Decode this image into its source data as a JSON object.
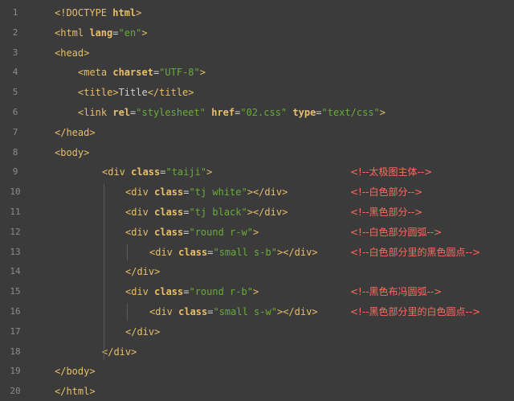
{
  "colors": {
    "background": "#3b3b3b",
    "line_number": "#8c8c8c",
    "tag": "#e8bf6a",
    "attribute_value": "#6aab3a",
    "plain": "#cfcfcf",
    "comment": "#ff6b5f"
  },
  "lines": [
    {
      "num": "1",
      "indent": 0,
      "tokens": [
        {
          "t": "doctype",
          "v": "<!DOCTYPE "
        },
        {
          "t": "doctype-kw",
          "v": "html"
        },
        {
          "t": "doctype",
          "v": ">"
        }
      ],
      "comment": ""
    },
    {
      "num": "2",
      "indent": 0,
      "tokens": [
        {
          "t": "tag",
          "v": "<html "
        },
        {
          "t": "attr",
          "v": "lang"
        },
        {
          "t": "eq",
          "v": "="
        },
        {
          "t": "val",
          "v": "\"en\""
        },
        {
          "t": "tag",
          "v": ">"
        }
      ],
      "comment": ""
    },
    {
      "num": "3",
      "indent": 0,
      "tokens": [
        {
          "t": "tag",
          "v": "<head>"
        }
      ],
      "comment": ""
    },
    {
      "num": "4",
      "indent": 1,
      "tokens": [
        {
          "t": "tag",
          "v": "<meta "
        },
        {
          "t": "attr",
          "v": "charset"
        },
        {
          "t": "eq",
          "v": "="
        },
        {
          "t": "val",
          "v": "\"UTF-8\""
        },
        {
          "t": "tag",
          "v": ">"
        }
      ],
      "comment": ""
    },
    {
      "num": "5",
      "indent": 1,
      "tokens": [
        {
          "t": "tag",
          "v": "<title>"
        },
        {
          "t": "text",
          "v": "Title"
        },
        {
          "t": "tag",
          "v": "</title>"
        }
      ],
      "comment": ""
    },
    {
      "num": "6",
      "indent": 1,
      "tokens": [
        {
          "t": "tag",
          "v": "<link "
        },
        {
          "t": "attr",
          "v": "rel"
        },
        {
          "t": "eq",
          "v": "="
        },
        {
          "t": "val",
          "v": "\"stylesheet\""
        },
        {
          "t": "text",
          "v": " "
        },
        {
          "t": "attr",
          "v": "href"
        },
        {
          "t": "eq",
          "v": "="
        },
        {
          "t": "val",
          "v": "\"02.css\""
        },
        {
          "t": "text",
          "v": " "
        },
        {
          "t": "attr",
          "v": "type"
        },
        {
          "t": "eq",
          "v": "="
        },
        {
          "t": "val",
          "v": "\"text/css\""
        },
        {
          "t": "tag",
          "v": ">"
        }
      ],
      "comment": ""
    },
    {
      "num": "7",
      "indent": 0,
      "tokens": [
        {
          "t": "tag",
          "v": "</head>"
        }
      ],
      "comment": ""
    },
    {
      "num": "8",
      "indent": 0,
      "tokens": [
        {
          "t": "tag",
          "v": "<body>"
        }
      ],
      "comment": ""
    },
    {
      "num": "9",
      "indent": 2,
      "tokens": [
        {
          "t": "tag",
          "v": "<div "
        },
        {
          "t": "attr",
          "v": "class"
        },
        {
          "t": "eq",
          "v": "="
        },
        {
          "t": "val",
          "v": "\"taiji\""
        },
        {
          "t": "tag",
          "v": ">"
        }
      ],
      "comment": "<!--太极图主体-->"
    },
    {
      "num": "10",
      "indent": 3,
      "tokens": [
        {
          "t": "tag",
          "v": "<div "
        },
        {
          "t": "attr",
          "v": "class"
        },
        {
          "t": "eq",
          "v": "="
        },
        {
          "t": "val",
          "v": "\"tj white\""
        },
        {
          "t": "tag",
          "v": "></div>"
        }
      ],
      "comment": "<!--白色部分-->"
    },
    {
      "num": "11",
      "indent": 3,
      "tokens": [
        {
          "t": "tag",
          "v": "<div "
        },
        {
          "t": "attr",
          "v": "class"
        },
        {
          "t": "eq",
          "v": "="
        },
        {
          "t": "val",
          "v": "\"tj black\""
        },
        {
          "t": "tag",
          "v": "></div>"
        }
      ],
      "comment": "<!--黑色部分-->"
    },
    {
      "num": "12",
      "indent": 3,
      "tokens": [
        {
          "t": "tag",
          "v": "<div "
        },
        {
          "t": "attr",
          "v": "class"
        },
        {
          "t": "eq",
          "v": "="
        },
        {
          "t": "val",
          "v": "\"round r-w\""
        },
        {
          "t": "tag",
          "v": ">"
        }
      ],
      "comment": "<!--白色部分圆弧-->"
    },
    {
      "num": "13",
      "indent": 4,
      "tokens": [
        {
          "t": "tag",
          "v": "<div "
        },
        {
          "t": "attr",
          "v": "class"
        },
        {
          "t": "eq",
          "v": "="
        },
        {
          "t": "val",
          "v": "\"small s-b\""
        },
        {
          "t": "tag",
          "v": "></div>"
        }
      ],
      "comment": "<!--白色部分里的黑色圆点-->"
    },
    {
      "num": "14",
      "indent": 3,
      "tokens": [
        {
          "t": "tag",
          "v": "</div>"
        }
      ],
      "comment": ""
    },
    {
      "num": "15",
      "indent": 3,
      "tokens": [
        {
          "t": "tag",
          "v": "<div "
        },
        {
          "t": "attr",
          "v": "class"
        },
        {
          "t": "eq",
          "v": "="
        },
        {
          "t": "val",
          "v": "\"round r-b\""
        },
        {
          "t": "tag",
          "v": ">"
        }
      ],
      "comment": "<!--黑色布冯圆弧-->"
    },
    {
      "num": "16",
      "indent": 4,
      "tokens": [
        {
          "t": "tag",
          "v": "<div "
        },
        {
          "t": "attr",
          "v": "class"
        },
        {
          "t": "eq",
          "v": "="
        },
        {
          "t": "val",
          "v": "\"small s-w\""
        },
        {
          "t": "tag",
          "v": "></div>"
        }
      ],
      "comment": "<!--黑色部分里的白色圆点-->"
    },
    {
      "num": "17",
      "indent": 3,
      "tokens": [
        {
          "t": "tag",
          "v": "</div>"
        }
      ],
      "comment": ""
    },
    {
      "num": "18",
      "indent": 2,
      "tokens": [
        {
          "t": "tag",
          "v": "</div>"
        }
      ],
      "comment": ""
    },
    {
      "num": "19",
      "indent": 0,
      "tokens": [
        {
          "t": "tag",
          "v": "</body>"
        }
      ],
      "comment": ""
    },
    {
      "num": "20",
      "indent": 0,
      "tokens": [
        {
          "t": "tag",
          "v": "</html>"
        }
      ],
      "comment": ""
    }
  ]
}
